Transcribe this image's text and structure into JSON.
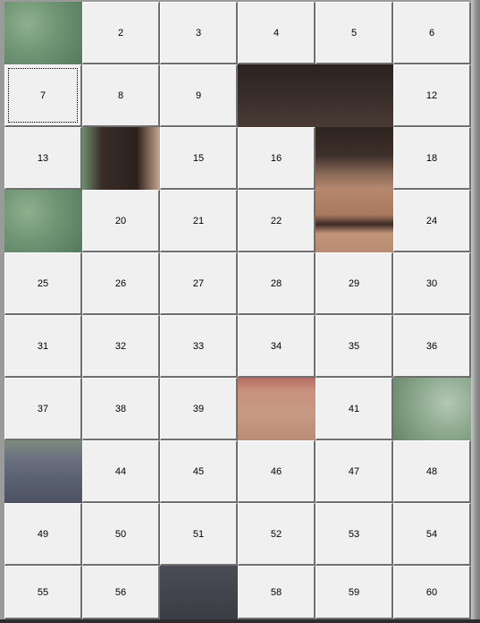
{
  "puzzle": {
    "tiles": [
      "",
      "2",
      "3",
      "4",
      "5",
      "6",
      "7",
      "8",
      "9",
      "",
      "",
      "12",
      "13",
      "",
      "15",
      "16",
      "",
      "18",
      "",
      "20",
      "21",
      "22",
      "",
      "24",
      "25",
      "26",
      "27",
      "28",
      "29",
      "30",
      "31",
      "32",
      "33",
      "34",
      "35",
      "36",
      "37",
      "38",
      "39",
      "",
      "41",
      "",
      "",
      "44",
      "45",
      "46",
      "47",
      "48",
      "49",
      "50",
      "51",
      "52",
      "53",
      "54",
      "55",
      "56",
      "",
      "58",
      "59",
      "60"
    ],
    "focused_tile": "7"
  }
}
